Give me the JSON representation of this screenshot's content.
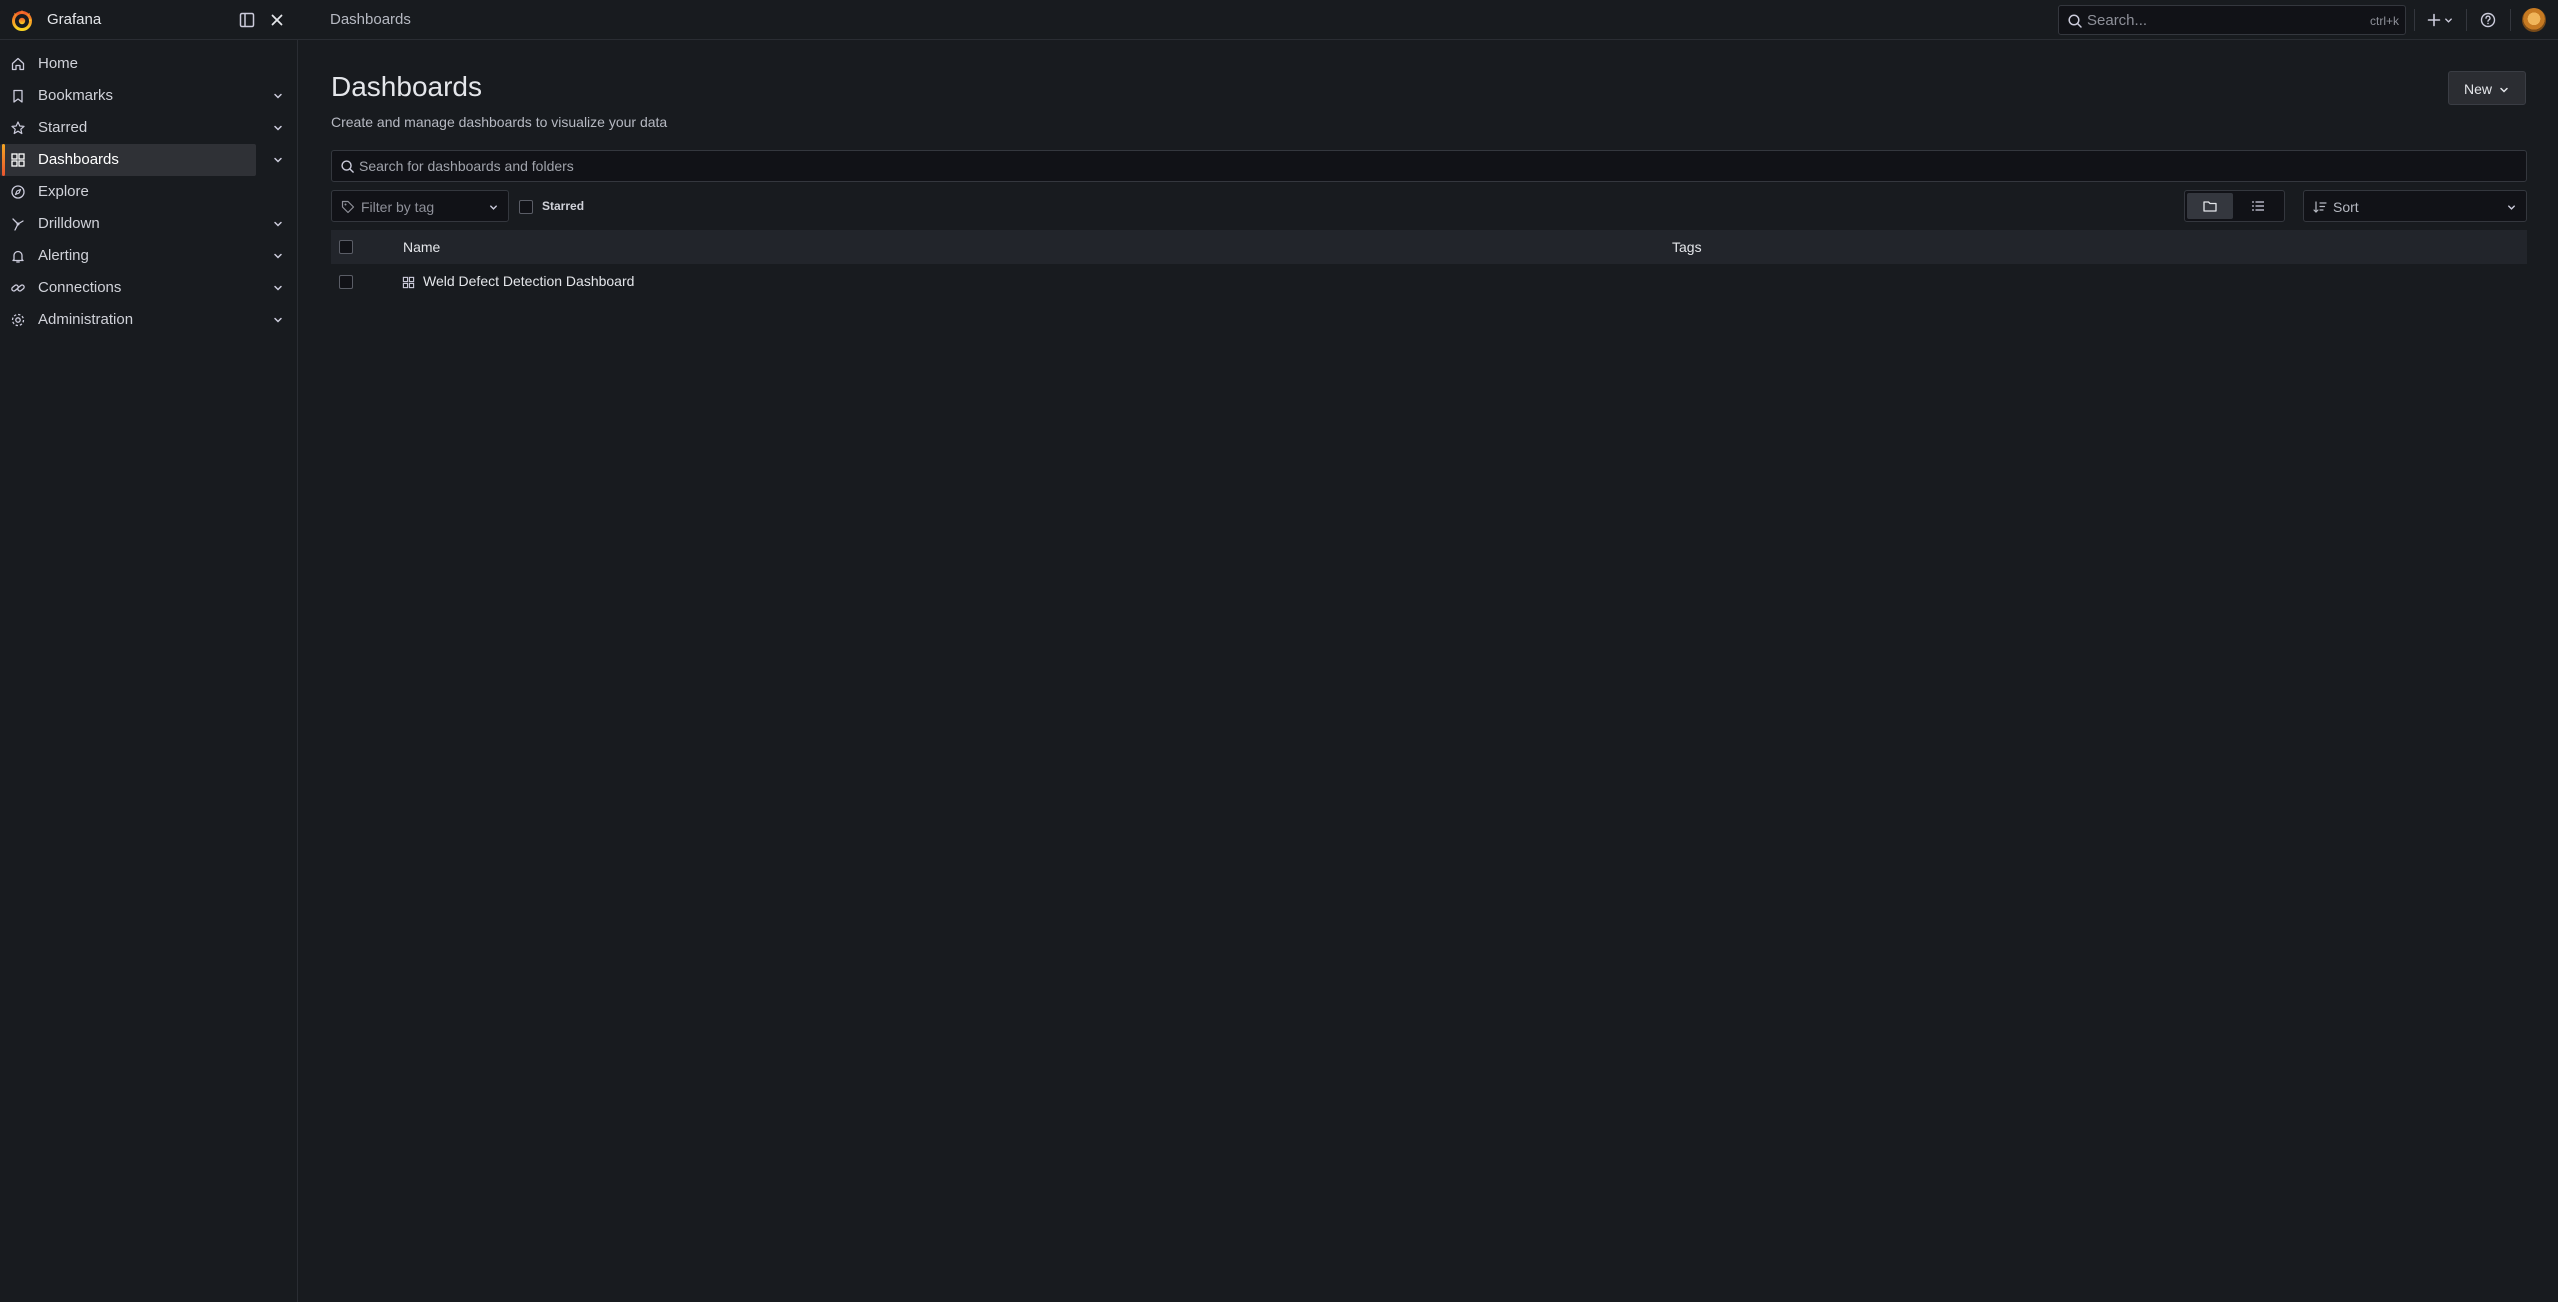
{
  "app": {
    "name": "Grafana"
  },
  "breadcrumb": {
    "current": "Dashboards"
  },
  "topbar": {
    "search_placeholder": "Search...",
    "search_shortcut": "ctrl+k",
    "icons": [
      "grafana-logo-icon",
      "dock-menu-icon",
      "close-icon",
      "search-icon",
      "plus-icon",
      "chevron-down-icon",
      "help-icon",
      "avatar"
    ]
  },
  "sidebar": {
    "items": [
      {
        "label": "Home",
        "icon": "home-icon",
        "expandable": false,
        "active": false
      },
      {
        "label": "Bookmarks",
        "icon": "bookmark-icon",
        "expandable": true,
        "active": false
      },
      {
        "label": "Starred",
        "icon": "star-icon",
        "expandable": true,
        "active": false
      },
      {
        "label": "Dashboards",
        "icon": "apps-grid-icon",
        "expandable": true,
        "active": true
      },
      {
        "label": "Explore",
        "icon": "compass-icon",
        "expandable": false,
        "active": false
      },
      {
        "label": "Drilldown",
        "icon": "drilldown-icon",
        "expandable": true,
        "active": false
      },
      {
        "label": "Alerting",
        "icon": "bell-icon",
        "expandable": true,
        "active": false
      },
      {
        "label": "Connections",
        "icon": "link-icon",
        "expandable": true,
        "active": false
      },
      {
        "label": "Administration",
        "icon": "cog-icon",
        "expandable": true,
        "active": false
      }
    ]
  },
  "page": {
    "title": "Dashboards",
    "subtitle": "Create and manage dashboards to visualize your data",
    "new_button": "New"
  },
  "filters": {
    "search_placeholder": "Search for dashboards and folders",
    "tag_filter_placeholder": "Filter by tag",
    "starred_label": "Starred",
    "sort_label": "Sort",
    "view_mode": "folders"
  },
  "table": {
    "columns": [
      "Name",
      "Tags"
    ],
    "rows": [
      {
        "name": "Weld Defect Detection Dashboard",
        "tags": ""
      }
    ]
  },
  "colors": {
    "background": "#181b1f",
    "accent_gradient_start": "#f5a623",
    "accent_gradient_end": "#e8542e",
    "active_item_bg": "#2f3136"
  }
}
